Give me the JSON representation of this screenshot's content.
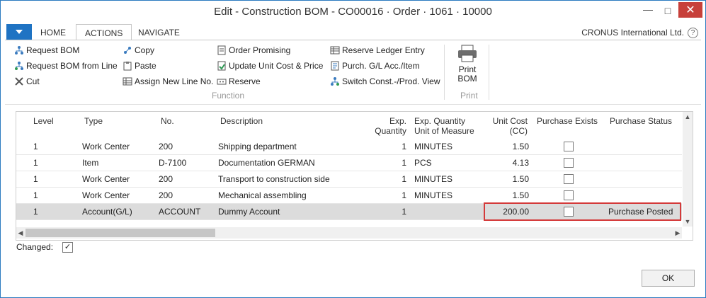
{
  "window": {
    "title": "Edit - Construction BOM - CO00016 · Order · 1061 · 10000",
    "controls": {
      "minimize": "—",
      "maximize": "□",
      "close": "✕"
    }
  },
  "ribbon": {
    "tabs": [
      "HOME",
      "ACTIONS",
      "NAVIGATE"
    ],
    "active_tab": "ACTIONS",
    "company": "CRONUS International Ltd.",
    "help": "?",
    "function_group": {
      "label": "Function",
      "actions": [
        {
          "label": "Request BOM",
          "icon": "request-bom-icon"
        },
        {
          "label": "Request BOM from Line",
          "icon": "request-bom-line-icon"
        },
        {
          "label": "Cut",
          "icon": "cut-icon"
        },
        {
          "label": "Copy",
          "icon": "copy-icon"
        },
        {
          "label": "Paste",
          "icon": "paste-icon"
        },
        {
          "label": "Assign New Line No.",
          "icon": "assign-line-icon"
        },
        {
          "label": "Order Promising",
          "icon": "order-promising-icon"
        },
        {
          "label": "Update Unit Cost & Price",
          "icon": "update-cost-icon"
        },
        {
          "label": "Reserve",
          "icon": "reserve-icon"
        },
        {
          "label": "Reserve Ledger Entry",
          "icon": "reserve-ledger-icon"
        },
        {
          "label": "Purch. G/L Acc./Item",
          "icon": "purch-gl-icon"
        },
        {
          "label": "Switch Const.-/Prod. View",
          "icon": "switch-view-icon"
        }
      ]
    },
    "print_group": {
      "label": "Print",
      "button": [
        "Print",
        "BOM"
      ]
    }
  },
  "grid": {
    "headers": {
      "level": "Level",
      "type": "Type",
      "no": "No.",
      "description": "Description",
      "exp_qty": [
        "Exp.",
        "Quantity"
      ],
      "exp_uom": [
        "Exp. Quantity",
        "Unit of Measure"
      ],
      "unit_cost": [
        "Unit Cost",
        "(CC)"
      ],
      "purchase_exists": "Purchase Exists",
      "purchase_status": "Purchase Status"
    },
    "rows": [
      {
        "level": "1",
        "type": "Work Center",
        "no": "200",
        "description": "Shipping department",
        "exp_qty": "1",
        "uom": "MINUTES",
        "unit_cost": "1.50",
        "purchase_exists": false,
        "purchase_status": ""
      },
      {
        "level": "1",
        "type": "Item",
        "no": "D-7100",
        "description": "Documentation GERMAN",
        "exp_qty": "1",
        "uom": "PCS",
        "unit_cost": "4.13",
        "purchase_exists": false,
        "purchase_status": ""
      },
      {
        "level": "1",
        "type": "Work Center",
        "no": "200",
        "description": "Transport to construction side",
        "exp_qty": "1",
        "uom": "MINUTES",
        "unit_cost": "1.50",
        "purchase_exists": false,
        "purchase_status": ""
      },
      {
        "level": "1",
        "type": "Work Center",
        "no": "200",
        "description": "Mechanical assembling",
        "exp_qty": "1",
        "uom": "MINUTES",
        "unit_cost": "1.50",
        "purchase_exists": false,
        "purchase_status": ""
      },
      {
        "level": "1",
        "type": "Account(G/L)",
        "no": "ACCOUNT",
        "description": "Dummy Account",
        "exp_qty": "1",
        "uom": "",
        "unit_cost": "200.00",
        "purchase_exists": false,
        "purchase_status": "Purchase Posted"
      }
    ],
    "selected_row": 4
  },
  "footer": {
    "changed_label": "Changed:",
    "changed_checked": true,
    "check_mark": "✓",
    "ok_label": "OK"
  },
  "colors": {
    "accent": "#1f73c3",
    "highlight": "#d43a3a",
    "selected_row": "#dcdcdc"
  }
}
